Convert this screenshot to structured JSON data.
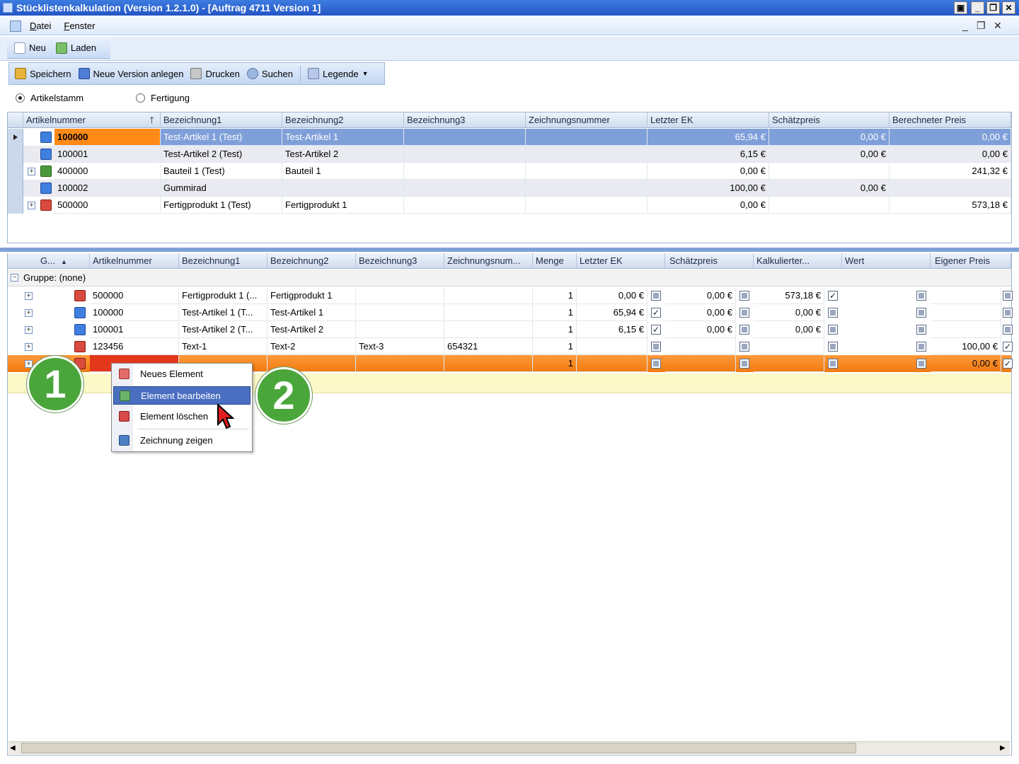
{
  "window": {
    "title": "Stücklistenkalkulation (Version 1.2.1.0) - [Auftrag 4711 Version 1]"
  },
  "menu": {
    "items": [
      "Datei",
      "Fenster"
    ]
  },
  "toolbar_top": {
    "new_label": "Neu",
    "load_label": "Laden"
  },
  "toolbar_main": {
    "save_label": "Speichern",
    "new_version_label": "Neue Version anlegen",
    "print_label": "Drucken",
    "search_label": "Suchen",
    "legend_label": "Legende"
  },
  "mode": {
    "option_a": "Artikelstamm",
    "option_b": "Fertigung",
    "selected": "Artikelstamm"
  },
  "top_grid": {
    "columns": [
      "Artikelnummer",
      "Bezeichnung1",
      "Bezeichnung2",
      "Bezeichnung3",
      "Zeichnungsnummer",
      "Letzter EK",
      "Schätzpreis",
      "Berechneter Preis"
    ],
    "rows": [
      {
        "nr": "100000",
        "b1": "Test-Artikel 1  (Test)",
        "b2": "Test-Artikel 1",
        "b3": "",
        "zn": "",
        "ek": "65,94 €",
        "sp": "0,00 €",
        "bp": "0,00 €"
      },
      {
        "nr": "100001",
        "b1": "Test-Artikel 2  (Test)",
        "b2": "Test-Artikel 2",
        "b3": "",
        "zn": "",
        "ek": "6,15 €",
        "sp": "0,00 €",
        "bp": "0,00 €"
      },
      {
        "nr": "400000",
        "b1": "Bauteil 1  (Test)",
        "b2": "Bauteil 1",
        "b3": "",
        "zn": "",
        "ek": "0,00 €",
        "sp": "",
        "bp": "241,32 €"
      },
      {
        "nr": "100002",
        "b1": "Gummirad",
        "b2": "",
        "b3": "",
        "zn": "",
        "ek": "100,00 €",
        "sp": "0,00 €",
        "bp": ""
      },
      {
        "nr": "500000",
        "b1": "Fertigprodukt 1  (Test)",
        "b2": "Fertigprodukt 1",
        "b3": "",
        "zn": "",
        "ek": "0,00 €",
        "sp": "",
        "bp": "573,18 €"
      }
    ]
  },
  "bottom_grid": {
    "columns": [
      "G...",
      "Artikelnummer",
      "Bezeichnung1",
      "Bezeichnung2",
      "Bezeichnung3",
      "Zeichnungsnum...",
      "Menge",
      "Letzter EK",
      "Schätzpreis",
      "Kalkulierter...",
      "Wert",
      "Eigener Preis"
    ],
    "group_label": "Gruppe:  (none)",
    "rows": [
      {
        "nr": "500000",
        "b1": "Fertigprodukt 1  (...",
        "b2": "Fertigprodukt 1",
        "b3": "",
        "zn": "",
        "menge": "1",
        "ek": "0,00 €",
        "ek_chk": false,
        "sp": "0,00 €",
        "sp_chk": false,
        "kp": "573,18 €",
        "kp_chk": true,
        "wert_chk": false,
        "ep": "",
        "ep_chk": false
      },
      {
        "nr": "100000",
        "b1": "Test-Artikel 1   (T...",
        "b2": "Test-Artikel 1",
        "b3": "",
        "zn": "",
        "menge": "1",
        "ek": "65,94 €",
        "ek_chk": true,
        "sp": "0,00 €",
        "sp_chk": false,
        "kp": "0,00 €",
        "kp_chk": false,
        "wert_chk": false,
        "ep": "",
        "ep_chk": false
      },
      {
        "nr": "100001",
        "b1": "Test-Artikel 2   (T...",
        "b2": "Test-Artikel 2",
        "b3": "",
        "zn": "",
        "menge": "1",
        "ek": "6,15 €",
        "ek_chk": true,
        "sp": "0,00 €",
        "sp_chk": false,
        "kp": "0,00 €",
        "kp_chk": false,
        "wert_chk": false,
        "ep": "",
        "ep_chk": false
      },
      {
        "nr": "123456",
        "b1": "Text-1",
        "b2": "Text-2",
        "b3": "Text-3",
        "zn": "654321",
        "menge": "1",
        "ek": "",
        "ek_chk": false,
        "sp": "",
        "sp_chk": false,
        "kp": "",
        "kp_chk": false,
        "wert_chk": false,
        "ep": "100,00 €",
        "ep_chk": true
      },
      {
        "nr": "",
        "b1": "",
        "b2": "",
        "b3": "",
        "zn": "",
        "menge": "1",
        "ek": "",
        "ek_chk": false,
        "sp": "",
        "sp_chk": false,
        "kp": "",
        "kp_chk": false,
        "wert_chk": false,
        "ep": "0,00 €",
        "ep_chk": true
      }
    ]
  },
  "context_menu": {
    "items": [
      "Neues Element",
      "Element bearbeiten",
      "Element löschen",
      "Zeichnung zeigen"
    ],
    "active": "Element bearbeiten"
  },
  "badges": {
    "one": "1",
    "two": "2"
  }
}
